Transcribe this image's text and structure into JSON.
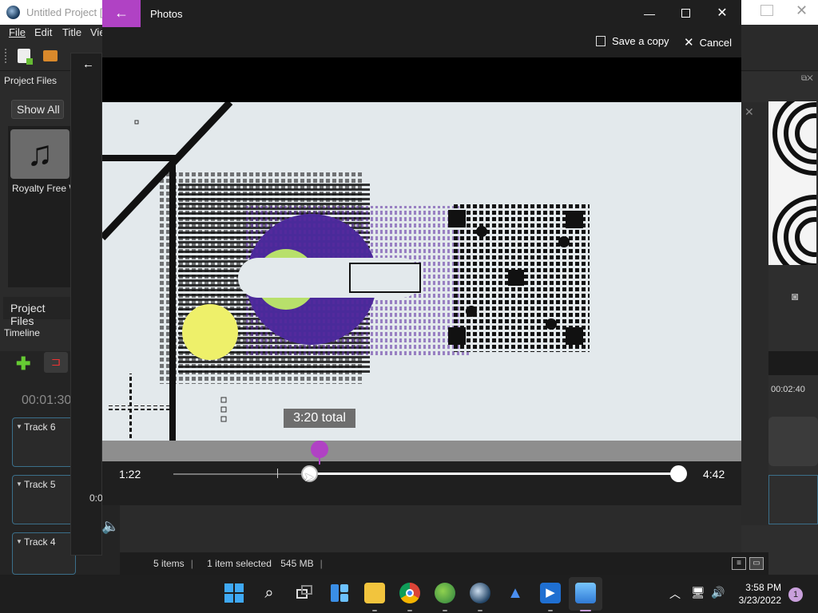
{
  "openshot": {
    "window_title": "Untitled Project [H",
    "menu": [
      "File",
      "Edit",
      "Title",
      "Vie"
    ],
    "project_files_title": "Project Files",
    "show_all_label": "Show All",
    "file_name": "Royalty Free W",
    "project_files_tab": "Project Files",
    "timeline_title": "Timeline",
    "timeline_time": "00:01:30",
    "tracks": [
      "Track 6",
      "Track 5",
      "Track 4"
    ],
    "ruler_time": "00:02:40",
    "mid_time": "0:0"
  },
  "photos": {
    "title": "Photos",
    "save_copy": "Save a copy",
    "cancel": "Cancel",
    "start_time": "1:22",
    "end_time": "4:42",
    "total_tooltip": "3:20 total",
    "accent_color": "#b042c4",
    "playhead_fraction": 0.29,
    "trim_start_fraction": 0.29,
    "trim_end_fraction": 1.0
  },
  "statusbar": {
    "items": "5 items",
    "selected": "1 item selected",
    "size": "545 MB"
  },
  "taskbar": {
    "icons": [
      "windows-start",
      "search",
      "task-view",
      "widgets",
      "file-explorer",
      "chrome",
      "app-green",
      "app-globe",
      "app-bird",
      "video-editor",
      "photos"
    ],
    "time": "3:58 PM",
    "date": "3/23/2022",
    "notifications": "1"
  }
}
